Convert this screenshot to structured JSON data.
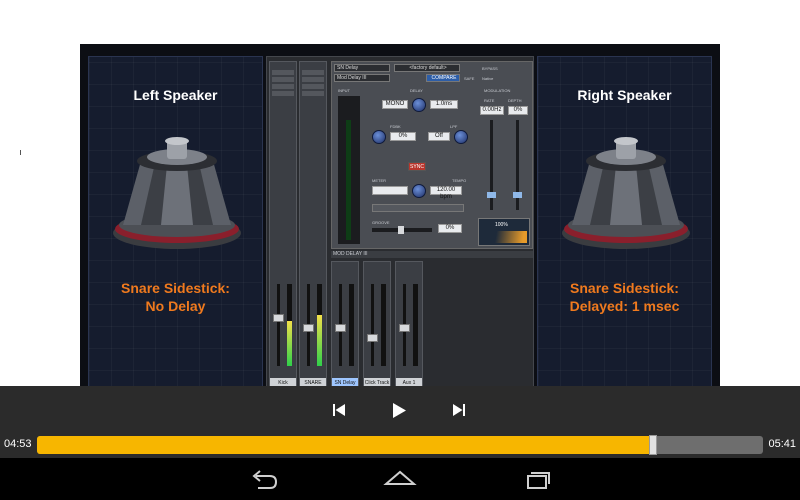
{
  "video": {
    "left_panel": {
      "title": "Left Speaker",
      "caption_line1": "Snare Sidestick:",
      "caption_line2": "No Delay"
    },
    "right_panel": {
      "title": "Right Speaker",
      "caption_line1": "Snare Sidestick:",
      "caption_line2": "Delayed:  1 msec"
    },
    "mixer": {
      "plugin": {
        "name": "SN Delay",
        "preset": "<factory default>",
        "insert": "Mod Delay III",
        "compare_label": "COMPARE",
        "bypass_label": "BYPASS",
        "safe_label": "SAFE",
        "native_label": "Native",
        "section_input": "INPUT",
        "section_delay": "DELAY",
        "section_modulation": "MODULATION",
        "mono_label": "MONO",
        "delay_value": "1.0ms",
        "fdbk_label": "FDBK",
        "fdbk_value": "0%",
        "lpf_label": "LPF",
        "lpf_value": "Off",
        "sync_label": "SYNC",
        "meter_label": "METER",
        "tempo_label": "TEMPO",
        "tempo_value": "120.00 bpm",
        "groove_label": "GROOVE",
        "groove_value": "0%",
        "rate_label": "RATE",
        "depth_label": "DEPTH",
        "rate_value": "0.00Hz",
        "depth_value": "0%",
        "mix_value": "100%",
        "footer": "MOD DELAY III"
      },
      "strips": [
        {
          "name": "Kick",
          "selected": false
        },
        {
          "name": "SNARE",
          "selected": false
        },
        {
          "name": "SN Delay",
          "selected": true
        },
        {
          "name": "Click Track",
          "selected": false
        },
        {
          "name": "Aux 1",
          "selected": false
        }
      ]
    }
  },
  "playback": {
    "time_current": "04:53",
    "time_total": "05:41",
    "progress": 0.849,
    "accent": "#f7b600"
  },
  "icons": {
    "prev": "skip-previous-icon",
    "play": "play-icon",
    "next": "skip-next-icon",
    "back": "back-icon",
    "home": "home-icon",
    "recents": "recent-apps-icon"
  }
}
